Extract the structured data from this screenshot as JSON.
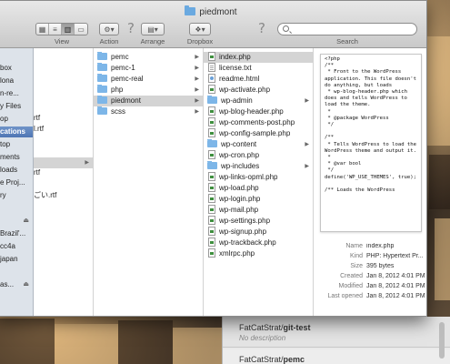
{
  "window": {
    "title": "piedmont"
  },
  "toolbar": {
    "view_label": "View",
    "action_label": "Action",
    "arrange_label": "Arrange",
    "dropbox_label": "Dropbox",
    "search_label": "Search",
    "search_placeholder": "",
    "help_glyph": "?"
  },
  "sidebar": {
    "items": [
      {
        "label": "box"
      },
      {
        "label": "lona"
      },
      {
        "label": "n-re..."
      },
      {
        "label": "y Files"
      },
      {
        "label": "op"
      },
      {
        "label": "cations",
        "selected": true
      },
      {
        "label": "top"
      },
      {
        "label": "ments"
      },
      {
        "label": "loads"
      },
      {
        "label": "e Proj..."
      },
      {
        "label": "ry"
      },
      {
        "label": ""
      },
      {
        "label": "Brazil'..."
      },
      {
        "label": "cc4a"
      },
      {
        "label": "japan"
      },
      {
        "label": "as..."
      }
    ]
  },
  "column1": {
    "items": [
      {
        "label": "rtf"
      },
      {
        "label": "l.rtf"
      },
      {
        "label": "",
        "selected": true
      },
      {
        "label": "rtf"
      },
      {
        "label": "ごい.rtf"
      }
    ]
  },
  "column2": {
    "items": [
      {
        "label": "pemc",
        "type": "folder"
      },
      {
        "label": "pemc-1",
        "type": "folder"
      },
      {
        "label": "pemc-real",
        "type": "folder"
      },
      {
        "label": "php",
        "type": "folder"
      },
      {
        "label": "piedmont",
        "type": "folder",
        "selected": true
      },
      {
        "label": "scss",
        "type": "folder"
      }
    ]
  },
  "column3": {
    "items": [
      {
        "label": "index.php",
        "type": "php",
        "selected": true
      },
      {
        "label": "license.txt",
        "type": "txt"
      },
      {
        "label": "readme.html",
        "type": "html"
      },
      {
        "label": "wp-activate.php",
        "type": "php"
      },
      {
        "label": "wp-admin",
        "type": "folder"
      },
      {
        "label": "wp-blog-header.php",
        "type": "php"
      },
      {
        "label": "wp-comments-post.php",
        "type": "php"
      },
      {
        "label": "wp-config-sample.php",
        "type": "php"
      },
      {
        "label": "wp-content",
        "type": "folder"
      },
      {
        "label": "wp-cron.php",
        "type": "php"
      },
      {
        "label": "wp-includes",
        "type": "folder"
      },
      {
        "label": "wp-links-opml.php",
        "type": "php"
      },
      {
        "label": "wp-load.php",
        "type": "php"
      },
      {
        "label": "wp-login.php",
        "type": "php"
      },
      {
        "label": "wp-mail.php",
        "type": "php"
      },
      {
        "label": "wp-settings.php",
        "type": "php"
      },
      {
        "label": "wp-signup.php",
        "type": "php"
      },
      {
        "label": "wp-trackback.php",
        "type": "php"
      },
      {
        "label": "xmlrpc.php",
        "type": "php"
      }
    ]
  },
  "preview": {
    "code": "<?php\n/**\n * Front to the WordPress application. This file doesn't do anything, but loads\n * wp-blog-header.php which does and tells WordPress to load the theme.\n *\n * @package WordPress\n */\n\n/**\n * Tells WordPress to load the WordPress theme and output it.\n *\n * @var bool\n */\ndefine('WP_USE_THEMES', true);\n\n/** Loads the WordPress",
    "meta": [
      {
        "key": "Name",
        "value": "index.php"
      },
      {
        "key": "Kind",
        "value": "PHP: Hypertext Pr..."
      },
      {
        "key": "Size",
        "value": "395 bytes"
      },
      {
        "key": "Created",
        "value": "Jan 8, 2012 4:01 PM"
      },
      {
        "key": "Modified",
        "value": "Jan 8, 2012 4:01 PM"
      },
      {
        "key": "Last opened",
        "value": "Jan 8, 2012 4:01 PM"
      }
    ]
  },
  "background_app": {
    "repo1_owner": "FatCatStrat/",
    "repo1_name": "git-test",
    "repo1_desc": "No description",
    "repo2_owner": "FatCatStrat/",
    "repo2_name": "pemc"
  }
}
